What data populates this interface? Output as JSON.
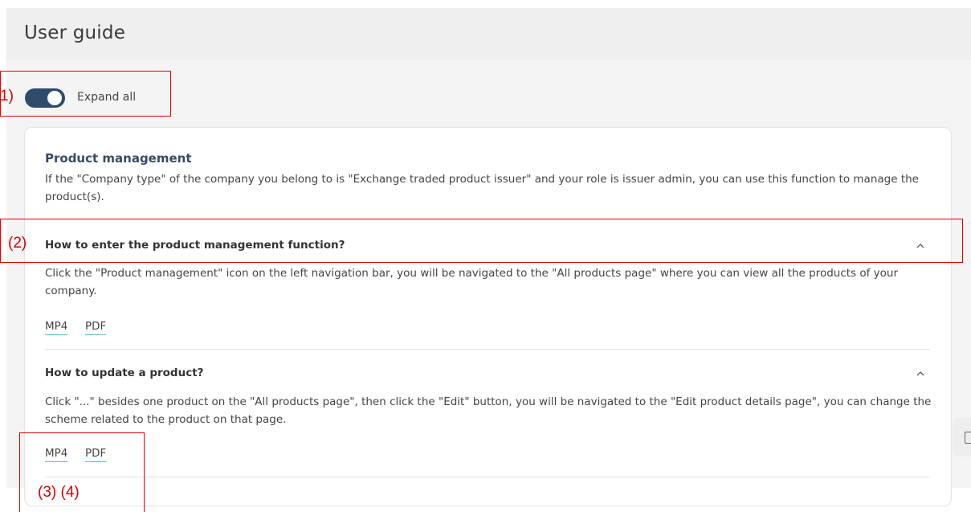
{
  "page": {
    "title": "User guide"
  },
  "toggle": {
    "label": "Expand all",
    "state": "on",
    "color": "#2f4b6b"
  },
  "section": {
    "title": "Product management",
    "description": "If the \"Company type\" of the company you belong to is \"Exchange traded product issuer\" and your role is issuer admin, you can use this function to manage the product(s)."
  },
  "faqs": [
    {
      "question": "How to enter the product management function?",
      "answer": "Click the \"Product management\" icon on the left navigation bar, you will be navigated to the \"All products page\" where you can view all the products of your company.",
      "links": [
        "MP4",
        "PDF"
      ],
      "expanded": true
    },
    {
      "question": "How to update a product?",
      "answer": "Click \"...\" besides one product on the \"All products page\", then click the \"Edit\" button, you will be navigated to the \"Edit product details page\", you can change the scheme related to the product on that page.",
      "links": [
        "MP4",
        "PDF"
      ],
      "expanded": true
    }
  ],
  "annotations": {
    "a1": "1)",
    "a2": "(2)",
    "a3": "(3) (4)"
  },
  "colors": {
    "annotation": "#e00000",
    "link_underline": "#5bb6c9",
    "section_title": "#364a63"
  }
}
